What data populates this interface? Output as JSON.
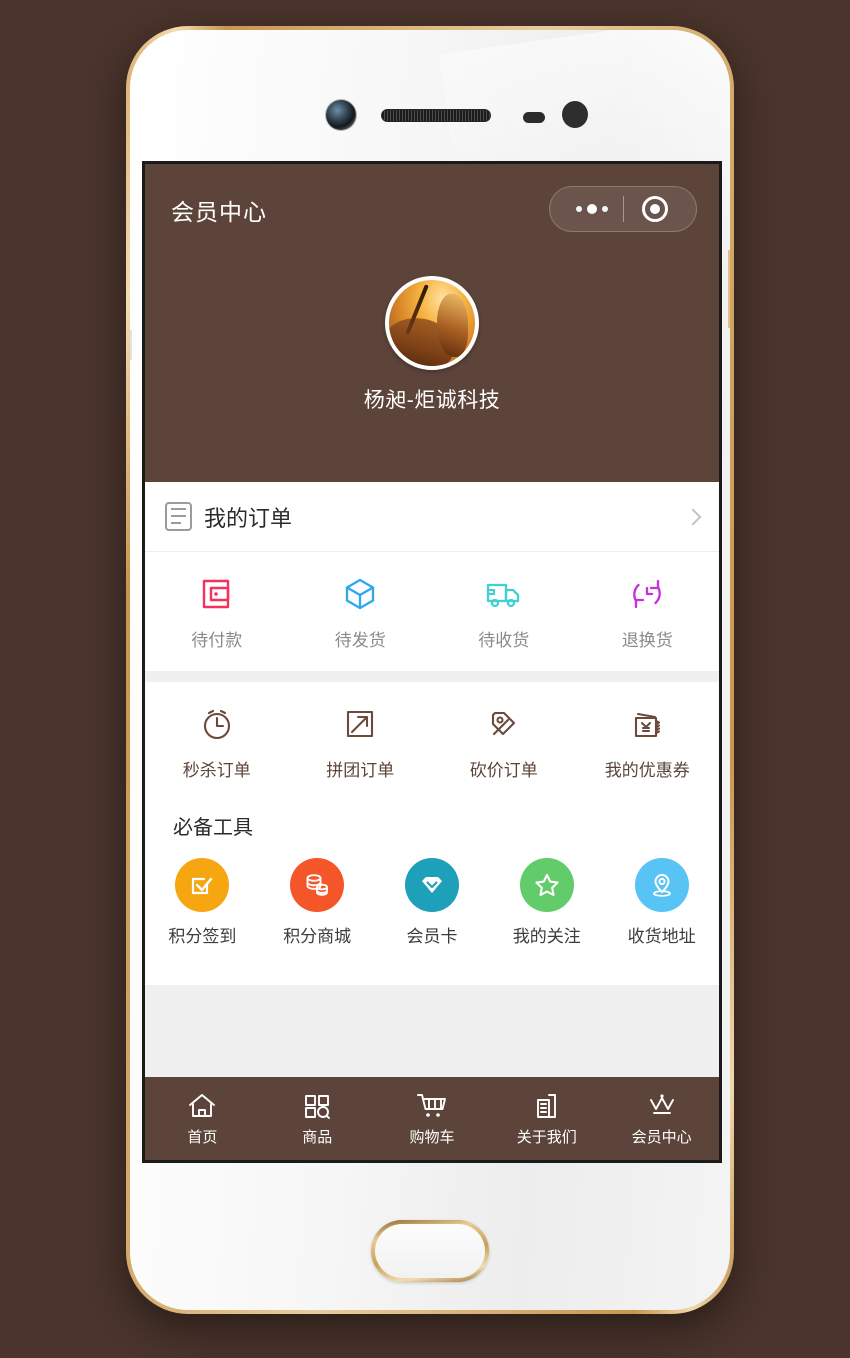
{
  "device": {
    "name": "white-gold-smartphone",
    "hardware": [
      "camera-lens",
      "earpiece-speaker",
      "proximity-sensor",
      "front-ir-sensor",
      "home-button"
    ]
  },
  "app": {
    "nav": {
      "title": "会员中心",
      "capsule": {
        "more_icon": "more-dots-icon",
        "target_icon": "target-circle-icon"
      }
    },
    "profile": {
      "avatar_icon": "user-avatar",
      "name": "杨昶-炬诚科技"
    },
    "order_card": {
      "icon": "order-document-icon",
      "title": "我的订单",
      "chevron": "chevron-right-icon",
      "statuses": [
        {
          "label": "待付款",
          "icon": "wallet-icon",
          "color": "#f5325c"
        },
        {
          "label": "待发货",
          "icon": "box-icon",
          "color": "#2ea7f0"
        },
        {
          "label": "待收货",
          "icon": "truck-icon",
          "color": "#3fd0d4"
        },
        {
          "label": "退换货",
          "icon": "refund-refresh-icon",
          "color": "#c72fe0"
        }
      ]
    },
    "order_types": [
      {
        "label": "秒杀订单",
        "icon": "alarm-clock-icon"
      },
      {
        "label": "拼团订单",
        "icon": "group-buy-arrow-icon"
      },
      {
        "label": "砍价订单",
        "icon": "price-tag-icon"
      },
      {
        "label": "我的优惠券",
        "icon": "coupon-yuan-icon"
      }
    ],
    "tools": {
      "heading": "必备工具",
      "items": [
        {
          "label": "积分签到",
          "icon": "checkbox-check-icon",
          "color": "#f5a611"
        },
        {
          "label": "积分商城",
          "icon": "coin-stack-icon",
          "color": "#f4562a"
        },
        {
          "label": "会员卡",
          "icon": "diamond-icon",
          "color": "#1e9fba"
        },
        {
          "label": "我的关注",
          "icon": "star-icon",
          "color": "#63cc6a"
        },
        {
          "label": "收货地址",
          "icon": "location-pin-icon",
          "color": "#58c3f5"
        }
      ]
    },
    "tabbar": [
      {
        "label": "首页",
        "icon": "home-icon"
      },
      {
        "label": "商品",
        "icon": "grid-search-icon"
      },
      {
        "label": "购物车",
        "icon": "shopping-cart-icon"
      },
      {
        "label": "关于我们",
        "icon": "building-icon"
      },
      {
        "label": "会员中心",
        "icon": "crown-icon"
      }
    ],
    "theme": {
      "brand_brown": "#5d443b",
      "page_bg": "#f0f0f0",
      "card_bg": "#ffffff",
      "page_outer_bg": "#4a342c"
    }
  }
}
